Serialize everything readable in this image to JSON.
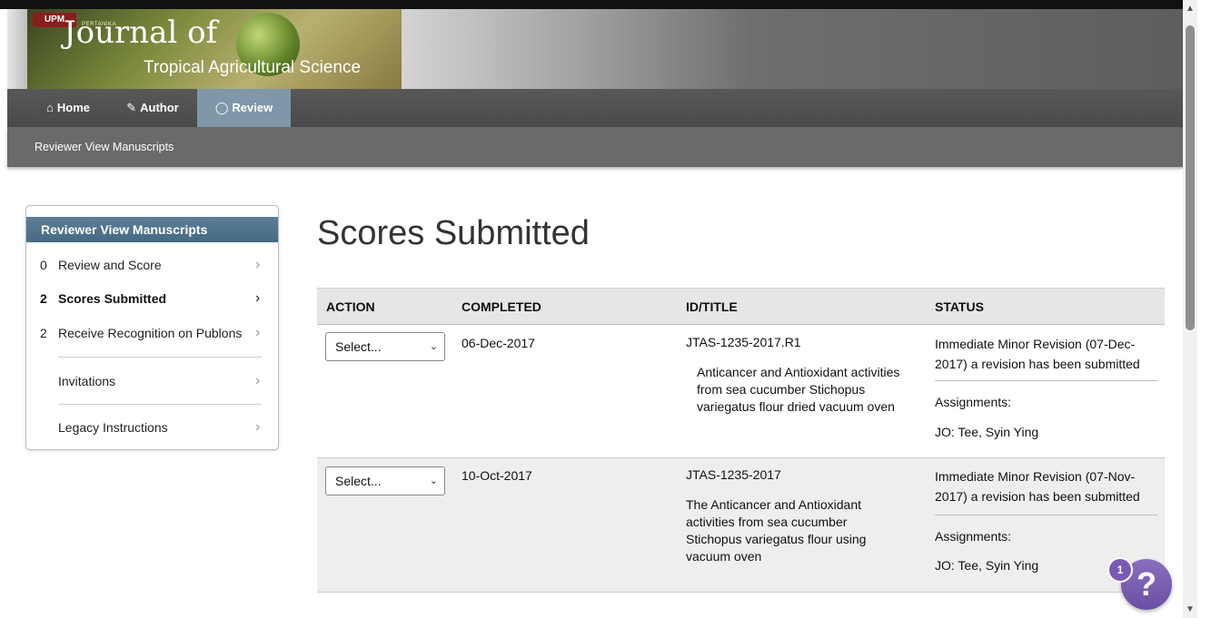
{
  "banner": {
    "logo_upm": "UPM",
    "logo_pertanika": "PERTANIKA",
    "logo_journal": "Journal of",
    "logo_subtitle": "Tropical Agricultural Science"
  },
  "nav": {
    "items": [
      {
        "icon": "home-icon",
        "label": "Home"
      },
      {
        "icon": "pencil-icon",
        "label": "Author"
      },
      {
        "icon": "speech-bubble-icon",
        "label": "Review"
      }
    ],
    "active": "Review"
  },
  "subnav": {
    "label": "Reviewer View Manuscripts"
  },
  "sidebar": {
    "header": "Reviewer View Manuscripts",
    "items": [
      {
        "count": "0",
        "label": "Review and Score",
        "bold": false
      },
      {
        "count": "2",
        "label": "Scores Submitted",
        "bold": true
      },
      {
        "count": "2",
        "label": "Receive Recognition on Publons",
        "bold": false
      },
      {
        "count": "",
        "label": "Invitations",
        "bold": false
      },
      {
        "count": "",
        "label": "Legacy Instructions",
        "bold": false
      }
    ],
    "chevron": "›"
  },
  "main": {
    "title": "Scores Submitted"
  },
  "table": {
    "headers": [
      "ACTION",
      "COMPLETED",
      "ID/TITLE",
      "STATUS"
    ],
    "rows": [
      {
        "action": "Select...",
        "completed": "06-Dec-2017",
        "id": "JTAS-1235-2017.R1",
        "title": "Anticancer and Antioxidant activities from sea cucumber Stichopus variegatus flour dried vacuum oven",
        "status": "Immediate Minor Revision (07-Dec-2017) a revision has been submitted",
        "assignments_label": "Assignments:",
        "assignee": "JO: Tee, Syin Ying"
      },
      {
        "action": "Select...",
        "completed": "10-Oct-2017",
        "id": "JTAS-1235-2017",
        "title": "The Anticancer and Antioxidant activities from sea cucumber Stichopus variegatus flour using vacuum oven",
        "status": "Immediate Minor Revision (07-Nov-2017) a revision has been submitted",
        "assignments_label": "Assignments:",
        "assignee": "JO: Tee, Syin Ying"
      }
    ]
  },
  "help": {
    "symbol": "?",
    "badge": "1"
  },
  "colors": {
    "nav_active": "#7f97a8",
    "sidebar_header": "#466a84",
    "help_button": "#6a4fa4"
  }
}
